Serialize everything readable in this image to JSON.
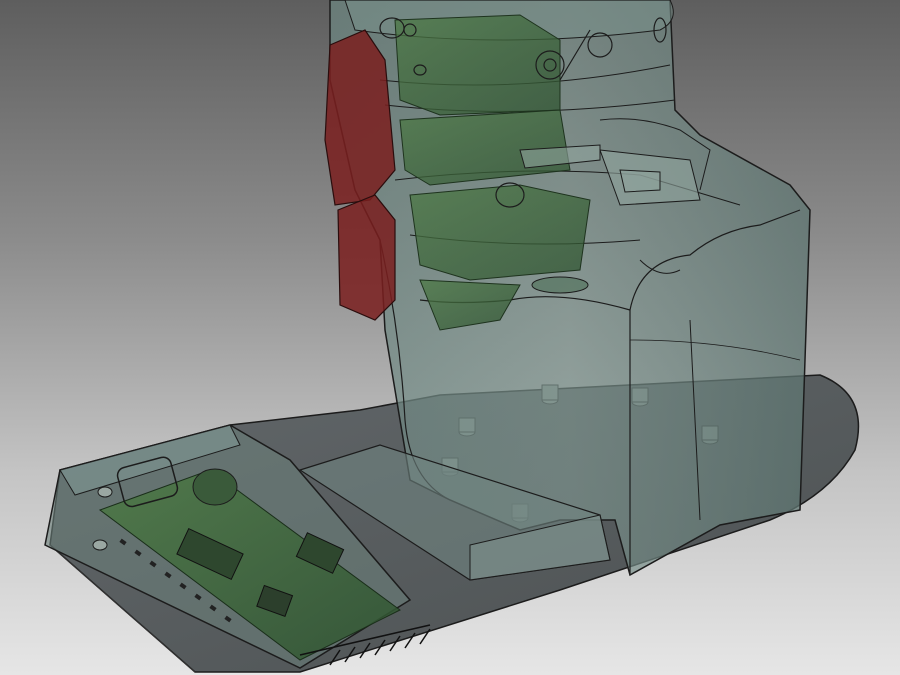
{
  "scene": {
    "background_top": "#5e5e5e",
    "background_bottom": "#e6e6e6",
    "model_colors": {
      "baseplate": "#5a5f5c",
      "shell": "#6f8a86",
      "pcb": "#3f6a3c",
      "switch": "#7a1e1e",
      "outline": "#1c1c1c"
    },
    "components": [
      "baseplate",
      "housing-shell",
      "pcb-stack",
      "rocker-switch",
      "microcontroller-board",
      "pin-header"
    ]
  }
}
